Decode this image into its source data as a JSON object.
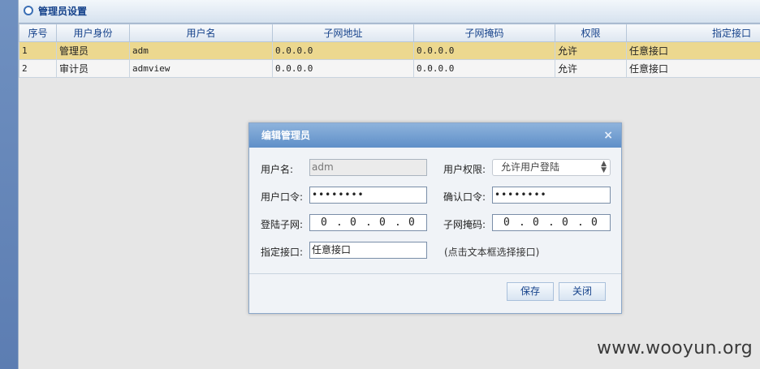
{
  "panel": {
    "title": "管理员设置"
  },
  "grid": {
    "columns": [
      "序号",
      "用户身份",
      "用户名",
      "子网地址",
      "子网掩码",
      "权限",
      "指定接口"
    ],
    "rows": [
      [
        "1",
        "管理员",
        "adm",
        "0.0.0.0",
        "0.0.0.0",
        "允许",
        "任意接口"
      ],
      [
        "2",
        "审计员",
        "admview",
        "0.0.0.0",
        "0.0.0.0",
        "允许",
        "任意接口"
      ]
    ]
  },
  "dialog": {
    "title": "编辑管理员",
    "close_icon": "×",
    "username_label": "用户名:",
    "username_value": "adm",
    "permission_label": "用户权限:",
    "permission_value": "允许用户登陆",
    "password_label": "用户口令:",
    "password_mask": "••••••••",
    "confirm_label": "确认口令:",
    "confirm_mask": "••••••••",
    "subnet_label": "登陆子网:",
    "subnet_value": [
      "0",
      "0",
      "0",
      "0"
    ],
    "mask_label": "子网掩码:",
    "mask_value": [
      "0",
      "0",
      "0",
      "0"
    ],
    "iface_label": "指定接口:",
    "iface_value": "任意接口",
    "iface_hint": "(点击文本框选择接口)",
    "save_label": "保存",
    "close_label": "关闭"
  },
  "watermark": "www.wooyun.org"
}
